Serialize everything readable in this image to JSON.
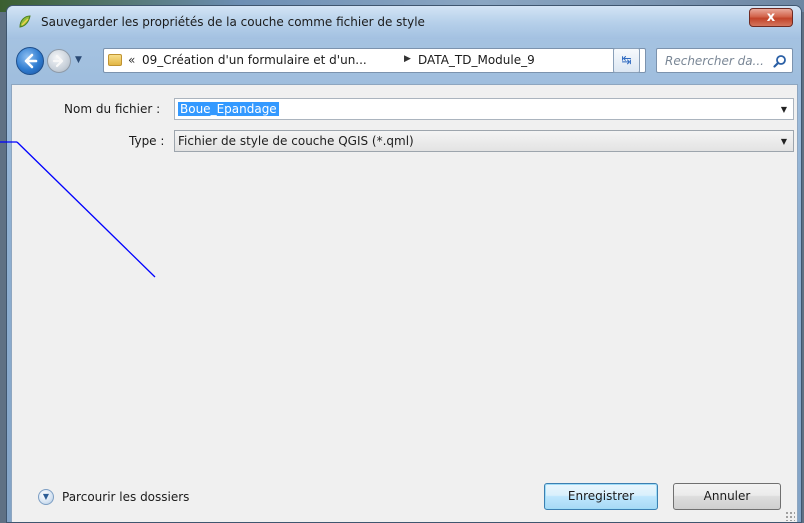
{
  "window": {
    "title": "Sauvegarder les propriétés de la couche comme fichier de style",
    "close_label": "x"
  },
  "navbar": {
    "path_prefix": "«",
    "path_segments": [
      "09_Création d'un formulaire et d'un...",
      "DATA_TD_Module_9"
    ],
    "search_placeholder": "Rechercher da..."
  },
  "form": {
    "filename_label": "Nom du fichier :",
    "filename_value": "Boue_Epandage",
    "type_label": "Type :",
    "type_value": "Fichier de style de couche QGIS (*.qml)"
  },
  "footer": {
    "browse_label": "Parcourir les dossiers",
    "save_label": "Enregistrer",
    "cancel_label": "Annuler"
  },
  "colors": {
    "selection": "#3399ff",
    "annotation_line": "#0000ff"
  }
}
